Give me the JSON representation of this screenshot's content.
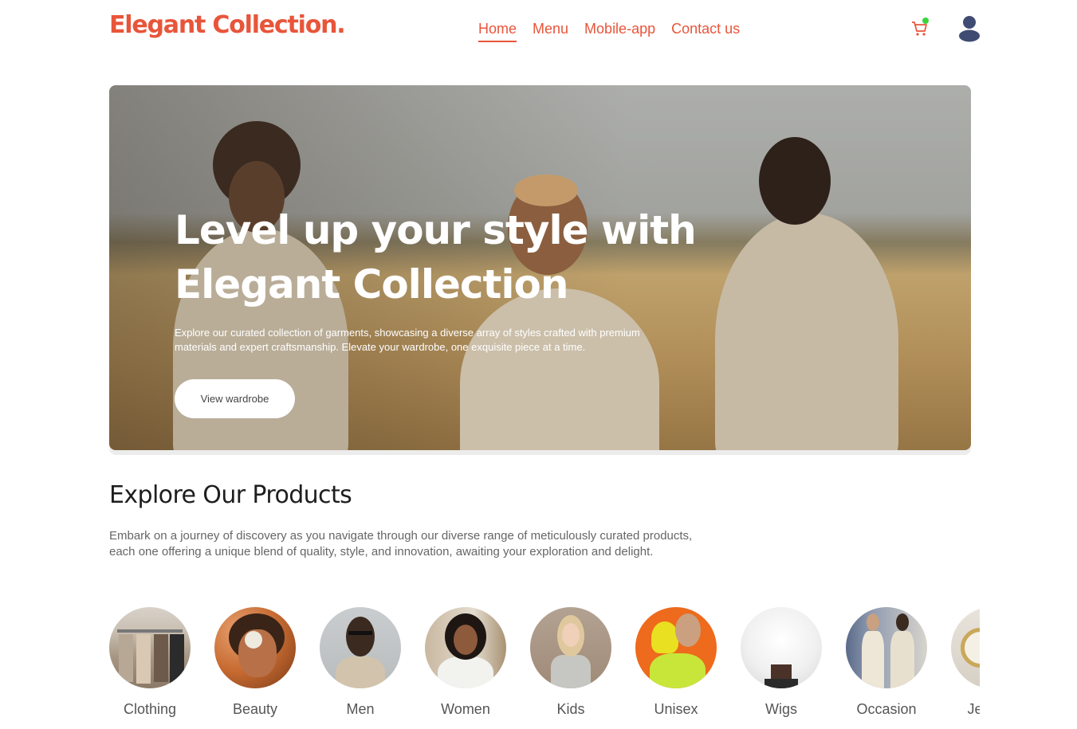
{
  "header": {
    "logo": "Elegant Collection.",
    "nav": [
      {
        "label": "Home",
        "active": true
      },
      {
        "label": "Menu",
        "active": false
      },
      {
        "label": "Mobile-app",
        "active": false
      },
      {
        "label": "Contact us",
        "active": false
      }
    ],
    "cart_icon": "cart-icon",
    "cart_badge_color": "#3bd43b",
    "user_icon": "user-icon"
  },
  "hero": {
    "title_line1": "Level up your style with",
    "title_line2": "Elegant Collection",
    "description": "Explore our curated collection of garments, showcasing a diverse array of styles crafted with premium materials and expert craftsmanship. Elevate your wardrobe, one exquisite piece at a time.",
    "button_label": "View wardrobe"
  },
  "explore": {
    "title": "Explore Our Products",
    "description": "Embark on a journey of discovery as you navigate through our diverse range of meticulously curated products, each one offering a unique blend of quality, style, and innovation, awaiting your exploration and delight.",
    "categories": [
      {
        "label": "Clothing"
      },
      {
        "label": "Beauty"
      },
      {
        "label": "Men"
      },
      {
        "label": "Women"
      },
      {
        "label": "Kids"
      },
      {
        "label": "Unisex"
      },
      {
        "label": "Wigs"
      },
      {
        "label": "Occasion"
      },
      {
        "label": "Jewelry"
      }
    ]
  },
  "colors": {
    "accent": "#e8553a",
    "text_dark": "#1e1e1e",
    "text_muted": "#666666"
  }
}
